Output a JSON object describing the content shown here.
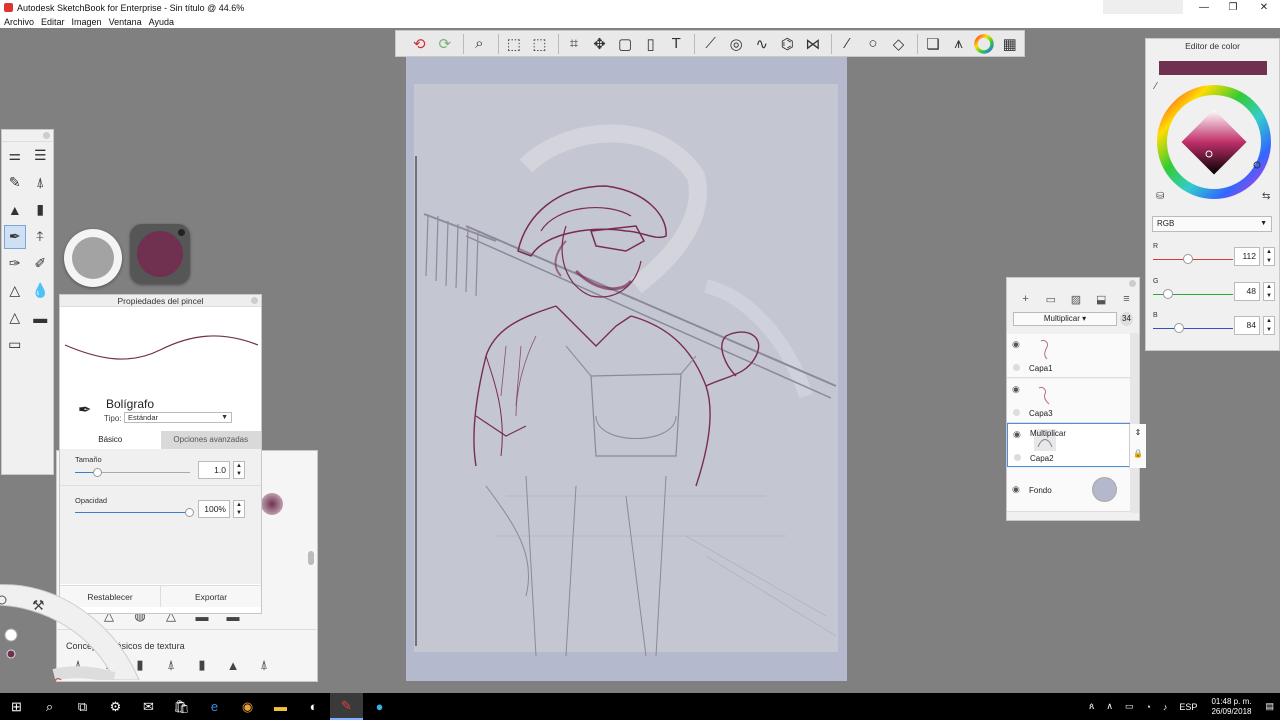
{
  "window": {
    "title": "Autodesk SketchBook for Enterprise - Sin título @ 44.6%",
    "controls": [
      "—",
      "❐",
      "✕"
    ]
  },
  "menu": [
    "Archivo",
    "Editar",
    "Imagen",
    "Ventana",
    "Ayuda"
  ],
  "toolbar": {
    "icons": [
      "undo-icon",
      "redo-icon",
      "zoom-icon",
      "select-icon",
      "transform-select-icon",
      "crop-icon",
      "distort-icon",
      "perspective-icon",
      "fill-icon",
      "text-icon",
      "ruler-icon",
      "ellipse-icon",
      "curve-icon",
      "perspective-grid-icon",
      "symmetry-icon",
      "line-icon",
      "circle-icon",
      "shape-icon",
      "layer-copy-icon",
      "brush-library-icon",
      "color-wheel-icon",
      "swatches-icon"
    ]
  },
  "brush_properties": {
    "title": "Propiedades del pincel",
    "brush_name": "Bolígrafo",
    "type_label": "Tipo:",
    "type_value": "Estándar",
    "tab_basic": "Básico",
    "tab_advanced": "Opciones avanzadas",
    "size_label": "Tamaño",
    "size_value": "1.0",
    "size_fraction": 0.2,
    "opacity_label": "Opacidad",
    "opacity_value": "100%",
    "opacity_fraction": 1.0,
    "reset_button": "Restablecer",
    "export_button": "Exportar"
  },
  "brush_library": {
    "section_label": "Conceptos básicos de textura"
  },
  "layers": {
    "blend_mode": "Multiplicar",
    "opacity_badge": "34",
    "items": [
      {
        "name": "Capa1",
        "mode": ""
      },
      {
        "name": "Capa3",
        "mode": ""
      },
      {
        "name": "Capa2",
        "mode": "Multiplicar"
      },
      {
        "name": "Fondo",
        "mode": ""
      }
    ]
  },
  "color_editor": {
    "title": "Editor de color",
    "current_color": "#70304f",
    "mode": "RGB",
    "channels": [
      {
        "label": "R",
        "value": "112",
        "fraction": 0.44,
        "color": "#d33c3c"
      },
      {
        "label": "G",
        "value": "48",
        "fraction": 0.19,
        "color": "#36a336"
      },
      {
        "label": "B",
        "value": "84",
        "fraction": 0.33,
        "color": "#3050c8"
      }
    ]
  },
  "taskbar": {
    "language": "ESP",
    "time": "01:48 p. m.",
    "date": "26/09/2018"
  }
}
